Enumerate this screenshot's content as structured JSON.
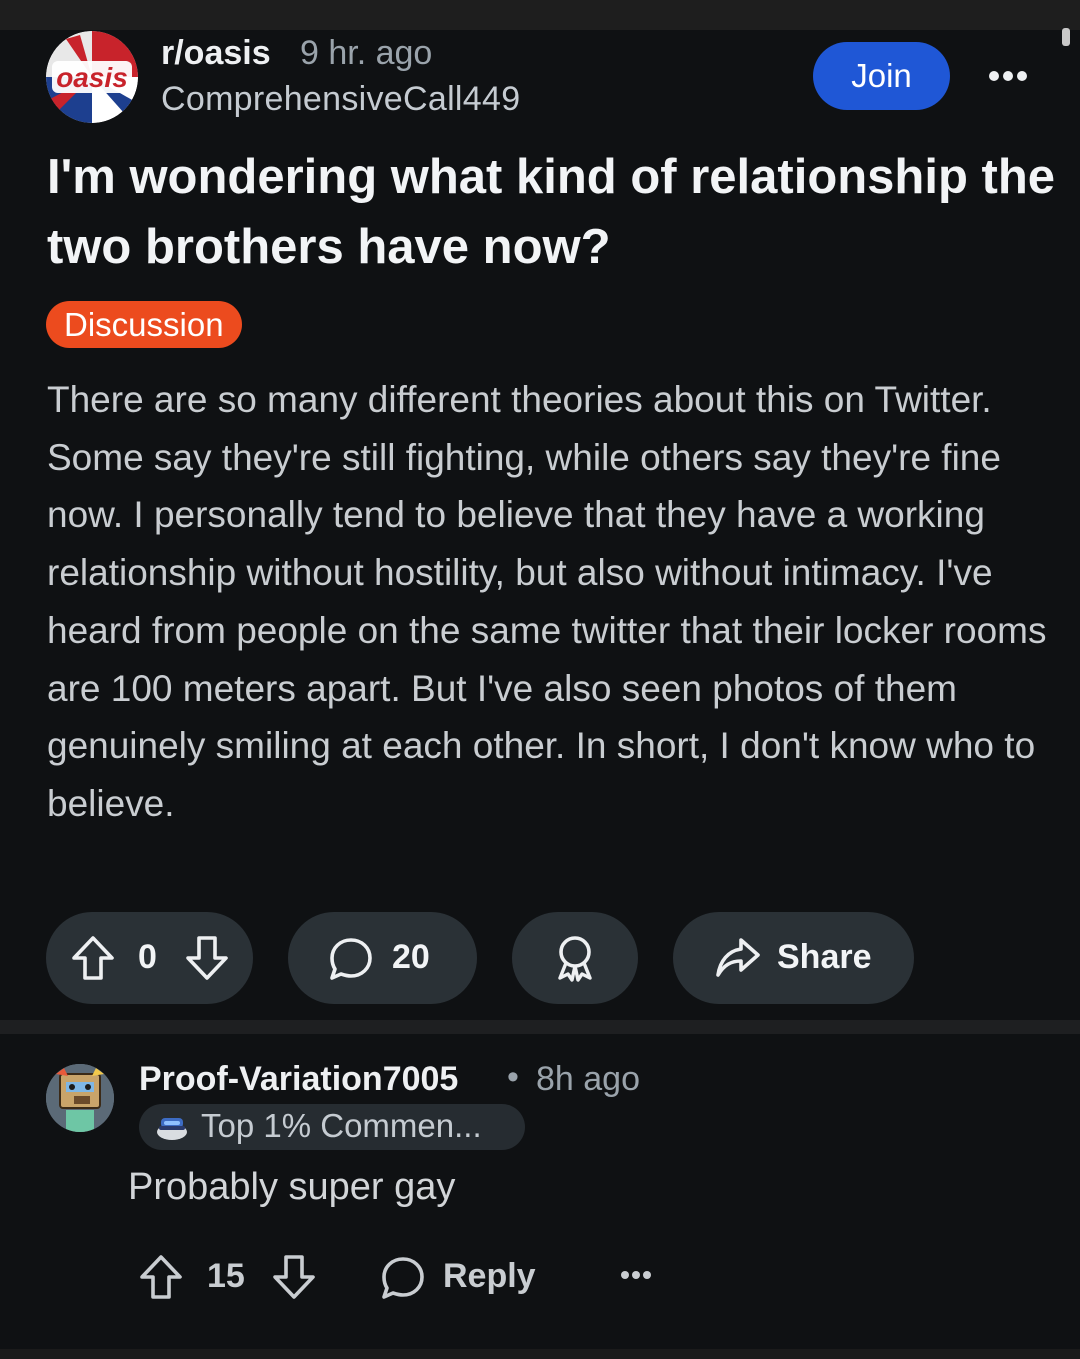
{
  "post": {
    "subreddit": "r/oasis",
    "subreddit_logo_text": "oasis",
    "time": "9 hr. ago",
    "author": "ComprehensiveCall449",
    "join_label": "Join",
    "title": "I'm wondering what kind of relationship the two brothers have now?",
    "flair": "Discussion",
    "body": "There are so many different theories about this on Twitter. Some say they're still fighting, while others say they're fine now. I personally tend to believe that they have a working relationship without hostility, but also without intimacy. I've heard from people on the same twitter that their locker rooms are 100 meters apart. But I've also seen photos of them genuinely smiling at each other. In short, I don't know who to believe.",
    "vote_count": "0",
    "comment_count": "20",
    "share_label": "Share"
  },
  "comment": {
    "author": "Proof-Variation7005",
    "separator": "•",
    "time": "8h ago",
    "badge": "Top 1% Commen...",
    "text": "Probably super gay",
    "vote_count": "15",
    "reply_label": "Reply"
  },
  "colors": {
    "background": "#0f1113",
    "join_button": "#1f57d6",
    "flair": "#ec4b1e",
    "pill": "#2a3136"
  },
  "icons": [
    "upvote-icon",
    "downvote-icon",
    "comment-icon",
    "award-icon",
    "share-icon",
    "more-icon",
    "reply-icon"
  ]
}
